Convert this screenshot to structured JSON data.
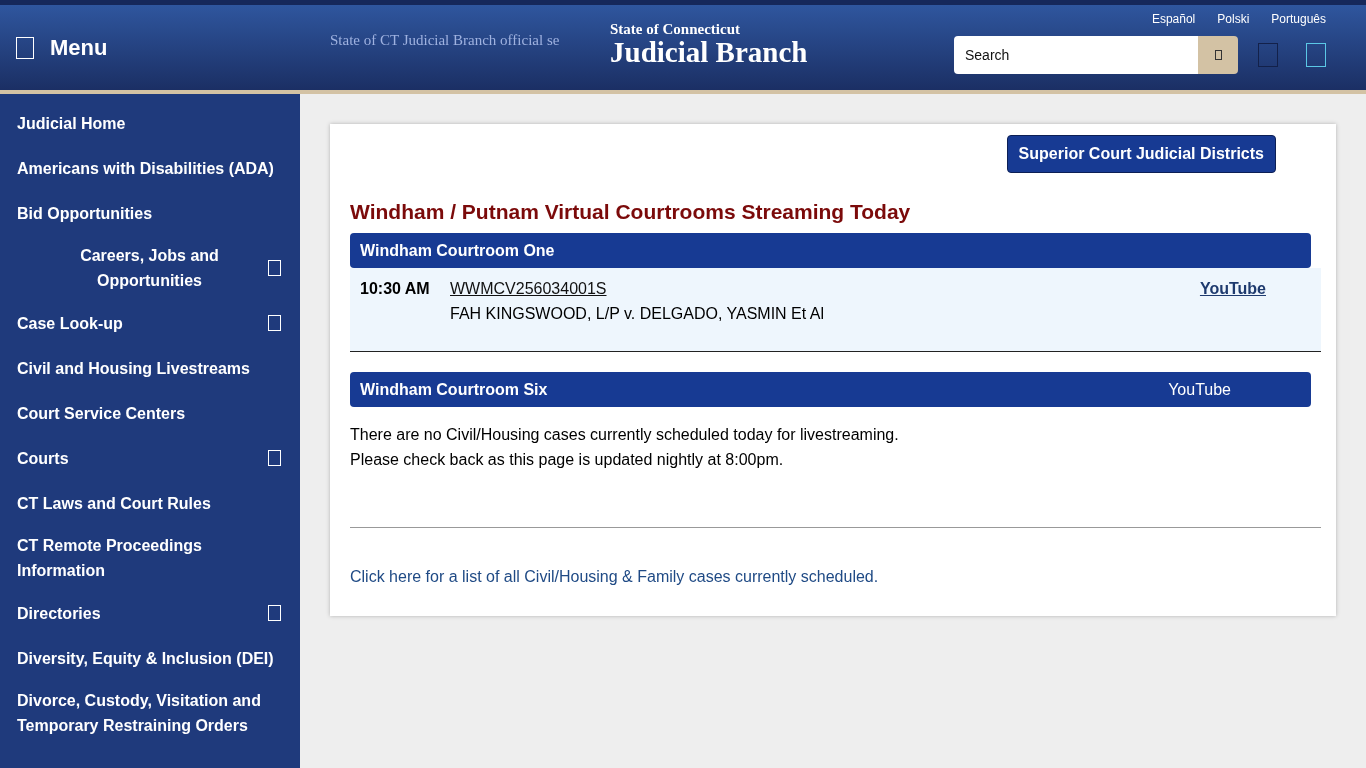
{
  "header": {
    "menu_label": "Menu",
    "seal_alt": "State of CT Judicial Branch official se",
    "subtitle": "State of Connecticut",
    "title": "Judicial Branch",
    "languages": [
      "Español",
      "Polski",
      "Português"
    ],
    "search": {
      "placeholder": "Search"
    }
  },
  "sidebar": {
    "items": [
      {
        "label": "Judicial Home",
        "expandable": false,
        "centered": false
      },
      {
        "label": "Americans with Disabilities (ADA)",
        "expandable": false,
        "centered": false
      },
      {
        "label": "Bid Opportunities",
        "expandable": false,
        "centered": false
      },
      {
        "label": "Careers, Jobs and Opportunities",
        "expandable": true,
        "centered": true
      },
      {
        "label": "Case Look-up",
        "expandable": true,
        "centered": false
      },
      {
        "label": "Civil and Housing Livestreams",
        "expandable": false,
        "centered": false
      },
      {
        "label": "Court Service Centers",
        "expandable": false,
        "centered": false
      },
      {
        "label": "Courts",
        "expandable": true,
        "centered": false
      },
      {
        "label": "CT Laws and Court Rules",
        "expandable": false,
        "centered": false
      },
      {
        "label": "CT Remote Proceedings Information",
        "expandable": false,
        "centered": false
      },
      {
        "label": "Directories",
        "expandable": true,
        "centered": false
      },
      {
        "label": "Diversity, Equity & Inclusion (DEI)",
        "expandable": false,
        "centered": false
      },
      {
        "label": "Divorce, Custody, Visitation and Temporary Restraining Orders",
        "expandable": false,
        "centered": false
      }
    ]
  },
  "content": {
    "districts_button": "Superior Court Judicial Districts",
    "heading": "Windham / Putnam Virtual Courtrooms Streaming Today",
    "courtrooms": [
      {
        "name": "Windham Courtroom One",
        "cases": [
          {
            "time": "10:30 AM",
            "docket": "WWMCV256034001S",
            "caption": "FAH KINGSWOOD, L/P v. DELGADO, YASMIN Et Al",
            "link": "YouTube"
          }
        ]
      },
      {
        "name": "Windham Courtroom Six",
        "header_link": "YouTube",
        "notice": [
          "There are no Civil/Housing cases currently scheduled today for livestreaming.",
          "Please check back as this page is updated nightly at 8:00pm."
        ]
      }
    ],
    "footer_link": "Click here for a list of all Civil/Housing & Family cases currently scheduled."
  }
}
